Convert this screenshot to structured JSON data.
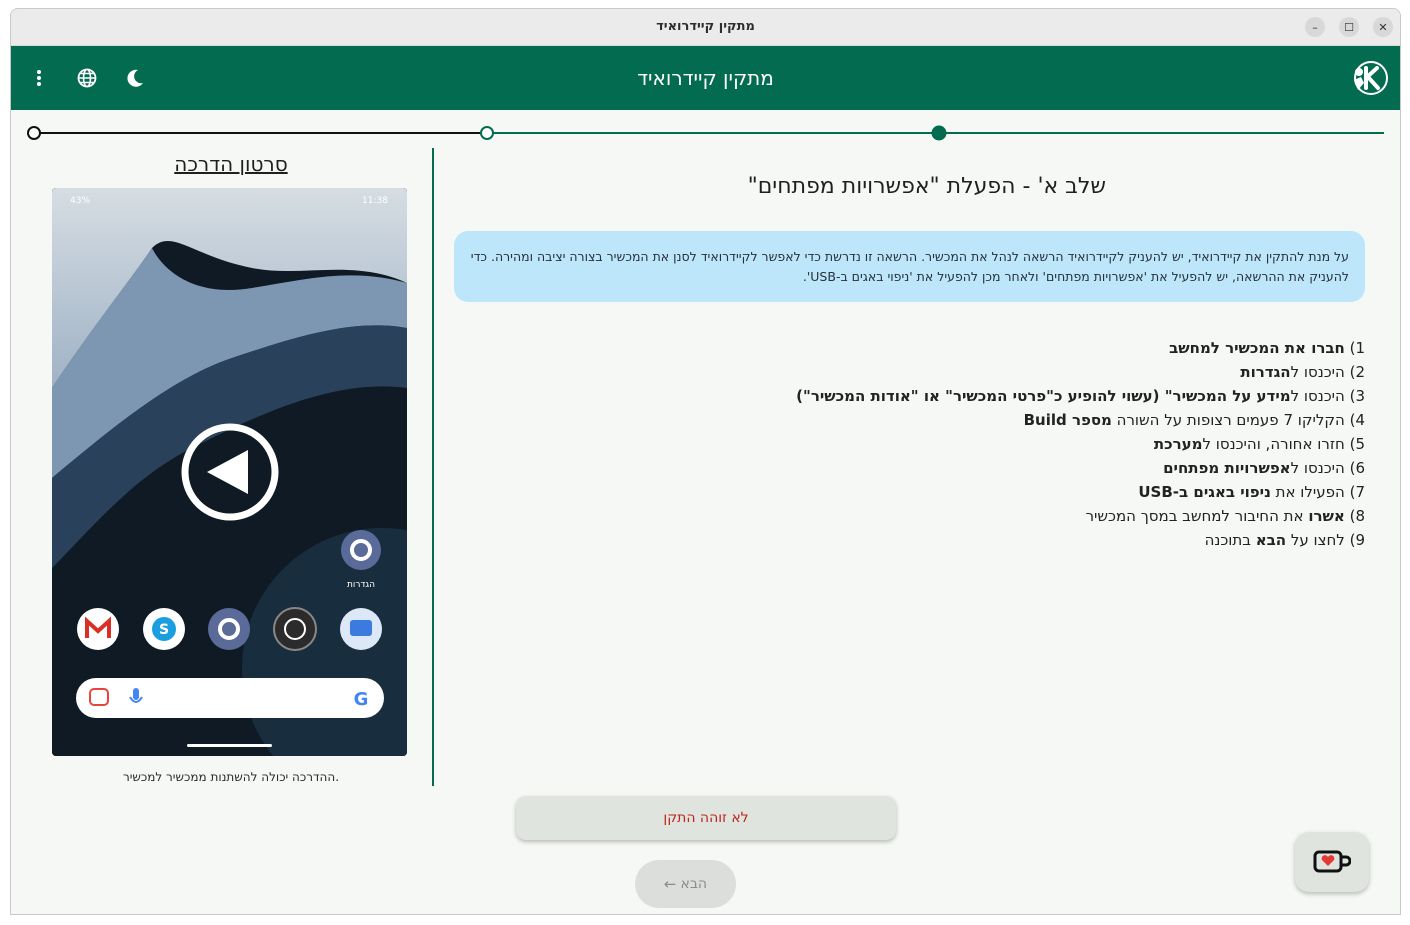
{
  "window": {
    "title": "מתקין קיידרואיד",
    "minimize_glyph": "–",
    "maximize_glyph": "☐",
    "close_glyph": "✕"
  },
  "appbar": {
    "title": "מתקין קיידרואיד",
    "icons": [
      "more-vert-icon",
      "globe-icon",
      "moon-icon",
      "kidroid-logo"
    ]
  },
  "stepper": {
    "total_steps": 3,
    "current_step": 3
  },
  "video": {
    "title": "סרטון הדרכה",
    "caption": "ההדרכה יכולה להשתנות ממכשיר למכשיר.",
    "phone_status": {
      "battery": "43%",
      "time": "11:38"
    },
    "settings_app_label": "הגדרות"
  },
  "step": {
    "heading": "שלב א' - הפעלת \"אפשרויות מפתחים\"",
    "info": "על מנת להתקין את קיידרואיד, יש להעניק לקיידרואיד הרשאה לנהל את המכשיר. הרשאה זו נדרשת כדי לאפשר לקיידרואיד לסנן את המכשיר בצורה יציבה ומהירה. כדי להעניק את ההרשאה, יש להפעיל את 'אפשרויות מפתחים' ולאחר מכן להפעיל את 'ניפוי באגים ב-USB'.",
    "items": [
      {
        "num": "1)",
        "pre": "",
        "bold": "חברו את המכשיר למחשב",
        "post": ""
      },
      {
        "num": "2)",
        "pre": "היכנסו ל",
        "bold": "הגדרות",
        "post": ""
      },
      {
        "num": "3)",
        "pre": "היכנסו ל",
        "bold": "מידע על המכשיר\" (עשוי להופיע כ\"פרטי המכשיר\" או \"אודות המכשיר\")",
        "post": ""
      },
      {
        "num": "4)",
        "pre": "הקליקו 7 פעמים רצופות על השורה ",
        "bold": "מספר Build",
        "post": ""
      },
      {
        "num": "5)",
        "pre": "חזרו אחורה, והיכנסו ל",
        "bold": "מערכת",
        "post": ""
      },
      {
        "num": "6)",
        "pre": "היכנסו ל",
        "bold": "אפשרויות מפתחים",
        "post": ""
      },
      {
        "num": "7)",
        "pre": "הפעילו את ",
        "bold": "ניפוי באגים ב-USB",
        "post": ""
      },
      {
        "num": "8)",
        "pre": "",
        "bold": "אשרו",
        "post": " את החיבור למחשב במסך המכשיר"
      },
      {
        "num": "9)",
        "pre": "לחצו על ",
        "bold": "הבא",
        "post": " בתוכנה"
      }
    ]
  },
  "buttons": {
    "not_found": "לא זוהה התקן",
    "next": "הבא",
    "next_arrow": "←"
  },
  "colors": {
    "brand": "#036b4f",
    "info_bg": "#bde6fb",
    "error_text": "#c0251c"
  }
}
